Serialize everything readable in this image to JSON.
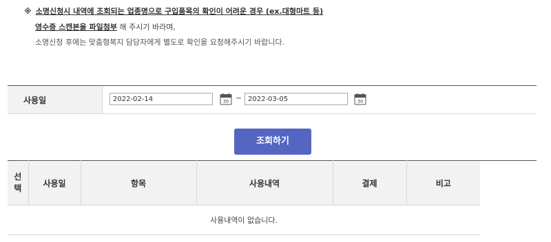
{
  "notice": {
    "mark": "※",
    "line1_underlined": "소명신청시 내역에 조회되는 업종명으로 구입품목의 확인이 어려운 경우 (ex.대형마트 등)",
    "line2_underlined": "영수증 스캔본을 파일첨부",
    "line2_rest": " 해 주시기 바라며,",
    "line3": "소명신청 후에는 맞춤형복지 담당자에게 별도로 확인을 요청해주시기 바랍니다."
  },
  "search": {
    "label": "사용일",
    "start_date": "2022-02-14",
    "end_date": "2022-03-05",
    "range_separator": "~",
    "calendar_icon_text": "30",
    "button_label": "조회하기"
  },
  "table": {
    "headers": [
      "선\n택",
      "사용일",
      "항목",
      "사용내역",
      "결제",
      "비고"
    ],
    "empty_message": "사용내역이 없습니다."
  },
  "colors": {
    "accent": "#5465c2",
    "header_bg": "#f2f2f2",
    "border_dark": "#555555",
    "border_light": "#d8d8d8"
  }
}
